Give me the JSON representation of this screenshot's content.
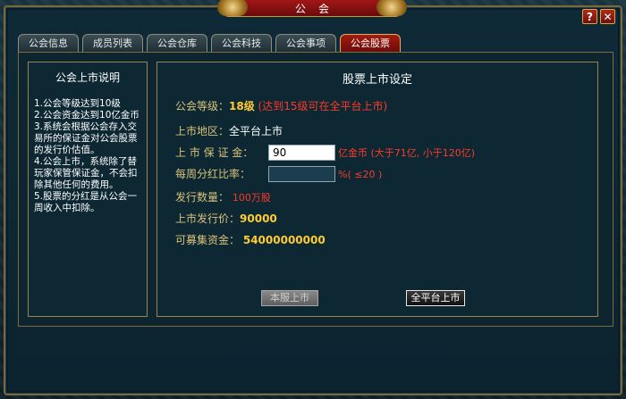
{
  "window": {
    "title": "公会",
    "help_glyph": "?",
    "close_glyph": "✕"
  },
  "tabs": [
    {
      "label": "公会信息"
    },
    {
      "label": "成员列表"
    },
    {
      "label": "公会仓库"
    },
    {
      "label": "公会科技"
    },
    {
      "label": "公会事项"
    },
    {
      "label": "公会股票",
      "active": true
    }
  ],
  "left_panel": {
    "title": "公会上市说明",
    "text": "1.公会等级达到10级\n2.公会资金达到10亿金币\n3.系统会根据公会存入交易所的保证金对公会股票的发行价估值。\n4.公会上市，系统除了替玩家保管保证金，不会扣除其他任何的费用。\n5.股票的分红是从公会一周收入中扣除。"
  },
  "right_panel": {
    "title": "股票上市设定",
    "level": {
      "label": "公会等级：",
      "value": "18级",
      "note": "(达到15级可在全平台上市)"
    },
    "region": {
      "label": "上市地区：",
      "value": "全平台上市"
    },
    "deposit": {
      "label": "上 市 保 证 金：",
      "value": "90",
      "note": "亿金币 (大于71亿, 小于120亿)"
    },
    "dividend": {
      "label": "每周分红比率：",
      "value": "",
      "note": "%( ≤20 )"
    },
    "shares": {
      "label": "发行数量：",
      "value": "100万股"
    },
    "price": {
      "label": "上市发行价：",
      "value": "90000"
    },
    "raise": {
      "label": "可募集资金：",
      "value": "54000000000"
    },
    "buttons": {
      "local": "本服上市",
      "all": "全平台上市"
    }
  },
  "colors": {
    "label_gold": "#d9c37a",
    "value_yellow": "#ffcc33",
    "note_red": "#ff3a2a",
    "tab_active": "#a31b12"
  }
}
